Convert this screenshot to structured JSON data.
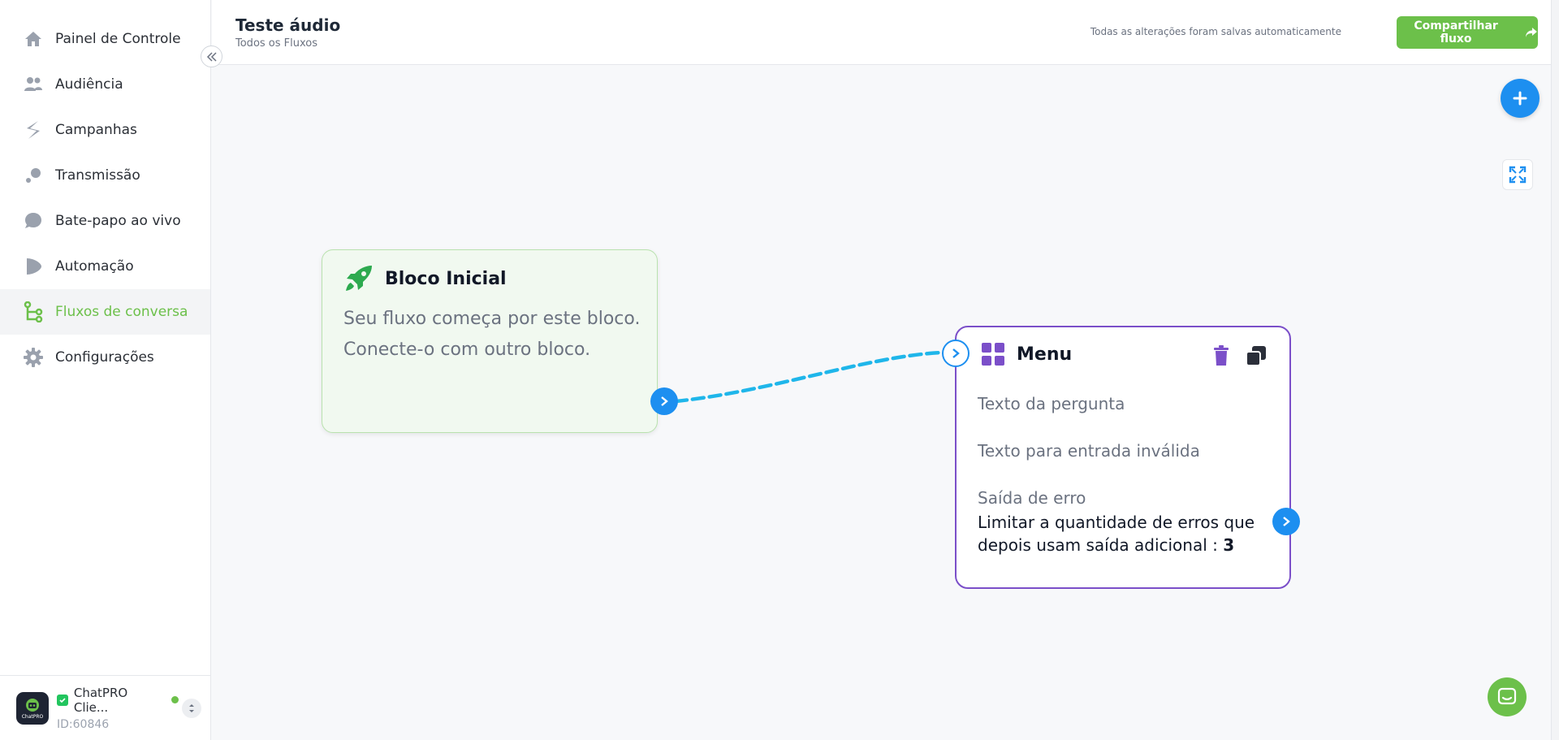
{
  "sidebar": {
    "items": [
      {
        "label": "Painel de Controle",
        "icon": "home-icon"
      },
      {
        "label": "Audiência",
        "icon": "users-icon"
      },
      {
        "label": "Campanhas",
        "icon": "campaign-icon"
      },
      {
        "label": "Transmissão",
        "icon": "broadcast-icon"
      },
      {
        "label": "Bate-papo ao vivo",
        "icon": "chat-bubble-icon"
      },
      {
        "label": "Automação",
        "icon": "play-icon"
      },
      {
        "label": "Fluxos de conversa",
        "icon": "flow-icon",
        "active": true
      },
      {
        "label": "Configurações",
        "icon": "gear-icon"
      }
    ],
    "account": {
      "name": "ChatPRO Clie...",
      "id": "ID:60846",
      "avatar_text": "ChatPRO"
    }
  },
  "header": {
    "title": "Teste áudio",
    "breadcrumb": "Todos os Fluxos",
    "save_status": "Todas as alterações foram salvas automaticamente",
    "share_label": "Compartilhar fluxo"
  },
  "canvas": {
    "start_block": {
      "title": "Bloco Inicial",
      "description": "Seu fluxo começa por este bloco. Conecte-o com outro bloco."
    },
    "menu_block": {
      "title": "Menu",
      "question_text": "Texto da pergunta",
      "invalid_text": "Texto para entrada inválida",
      "error_exit": "Saída de erro",
      "limit_text": "Limitar a quantidade de erros que depois usam saída adicional : ",
      "limit_value": "3"
    }
  },
  "colors": {
    "accent_green": "#6cc04a",
    "accent_blue": "#1d8ff0",
    "menu_border": "#7b4fc9",
    "edge": "#1fb6ea"
  }
}
